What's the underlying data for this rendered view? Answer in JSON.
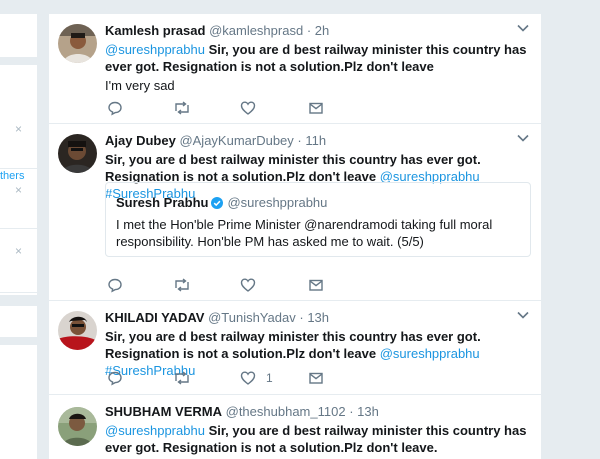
{
  "tweets": [
    {
      "fullname": "Kamlesh prasad",
      "handle": "@kamleshprasd",
      "time": "2h",
      "mention": "@sureshpprabhu",
      "text_bold": "Sir, you are d best railway minister this country has ever got. Resignation is not a solution.Plz don't leave",
      "text_plain": "I'm very sad"
    },
    {
      "fullname": "Ajay Dubey",
      "handle": "@AjayKumarDubey",
      "time": "11h",
      "text_bold": "Sir, you are d best railway minister this country has ever got. Resignation is not a solution.Plz don't leave",
      "mention": "@sureshpprabhu",
      "hashtag": "#SureshPrabhu",
      "quote": {
        "fullname": "Suresh Prabhu",
        "handle": "@sureshpprabhu",
        "text": "I met the Hon'ble Prime Minister @narendramodi taking full moral responsibility. Hon'ble PM has asked me to wait. (5/5)"
      }
    },
    {
      "fullname": "KHILADI YADAV",
      "handle": "@TunishYadav",
      "time": "13h",
      "text_bold": "Sir, you are d best railway minister this country has ever got. Resignation is not a solution.Plz don't leave",
      "mention": "@sureshpprabhu",
      "hashtag": "#SureshPrabhu",
      "like_count": "1"
    },
    {
      "fullname": "SHUBHAM VERMA",
      "handle": "@theshubham_1102",
      "time": "13h",
      "mention": "@sureshpprabhu",
      "text_bold": "Sir, you are d best railway minister this country has ever got. Resignation is not a solution.Plz don't leave."
    }
  ],
  "sidebar": {
    "others_link": "thers",
    "close_glyph": "×"
  },
  "separator": "·",
  "icons": [
    "reply-icon",
    "retweet-icon",
    "like-icon",
    "direct-message-icon",
    "chevron-down-icon",
    "verified-badge-icon"
  ],
  "colors": {
    "link": "#1b95e0",
    "background": "#e6ecf0",
    "muted": "#657786",
    "verified": "#1da1f2"
  }
}
